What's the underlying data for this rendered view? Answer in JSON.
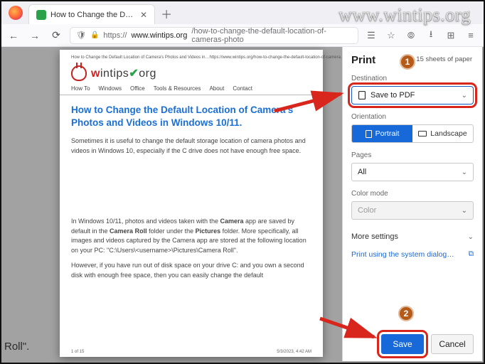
{
  "watermark": "www.wintips.org",
  "tab": {
    "title": "How to Change the Default Loc"
  },
  "url": {
    "scheme": "https://",
    "host": "www.wintips.org",
    "path": "/how-to-change-the-default-location-of-cameras-photo"
  },
  "bg_snippet": "Roll\".",
  "preview": {
    "header_left": "How to Change the Default Location of Camera's Photos and Videos in…",
    "header_right": "https://www.wintips.org/how-to-change-the-default-location-of-camera…",
    "brand": {
      "word1": "w",
      "word2": "intips",
      "check": "✔",
      "word3": "org"
    },
    "nav": [
      "How To",
      "Windows",
      "Office",
      "Tools & Resources",
      "About",
      "Contact"
    ],
    "title": "How to Change the Default Location of Camera's Photos and Videos in Windows 10/11.",
    "para1": "Sometimes it is useful to change the default storage location of camera photos and videos in Windows 10, especially if the C drive does not have enough free space.",
    "para2_a": "In Windows 10/11, photos and videos taken with the ",
    "para2_b": "Camera",
    "para2_c": " app are saved by default in the ",
    "para2_d": "Camera Roll",
    "para2_e": " folder under the ",
    "para2_f": "Pictures",
    "para2_g": " folder. More specifically, all images and videos captured by the Camera app are stored at the following location on your PC: \"C:\\Users\\<username>\\Pictures\\Camera Roll\".",
    "para3": "However, if you have run out of disk space on your drive C: and you own a second disk with enough free space, then you can easily change the default",
    "footer_left": "1 of 15",
    "footer_right": "5/3/2023, 4:42 AM"
  },
  "print": {
    "heading": "Print",
    "sheets": "15 sheets of paper",
    "dest_label": "Destination",
    "dest_value": "Save to PDF",
    "orient_label": "Orientation",
    "orient_portrait": "Portrait",
    "orient_landscape": "Landscape",
    "pages_label": "Pages",
    "pages_value": "All",
    "color_label": "Color mode",
    "color_value": "Color",
    "more": "More settings",
    "syslink": "Print using the system dialog…",
    "save": "Save",
    "cancel": "Cancel"
  },
  "badges": {
    "one": "1",
    "two": "2"
  }
}
